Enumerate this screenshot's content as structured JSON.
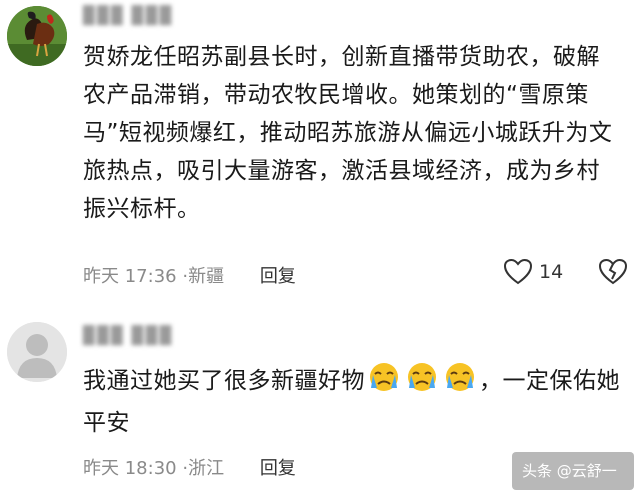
{
  "comments": [
    {
      "username": "▉▉▉ ▉▉▉",
      "text": "贺娇龙任昭苏副县长时，创新直播带货助农，破解农产品滞销，带动农牧民增收。她策划的“雪原策马”短视频爆红，推动昭苏旅游从偏远小城跃升为文旅热点，吸引大量游客，激活县域经济，成为乡村振兴标杆。",
      "time": "昨天 17:36",
      "location": "新疆",
      "reply_label": "回复",
      "likes": "14",
      "avatar_icon": "rooster-avatar"
    },
    {
      "username": "▉▉▉ ▉▉▉",
      "text_before": "我通过她买了很多新疆好物",
      "emoji_icons": [
        "crying-face-icon",
        "crying-face-icon",
        "crying-face-icon"
      ],
      "text_after": "，一定保佑她平安",
      "time": "昨天 18:30",
      "location": "浙江",
      "reply_label": "回复",
      "avatar_icon": "default-avatar"
    }
  ],
  "watermark": "头条 @云舒一"
}
